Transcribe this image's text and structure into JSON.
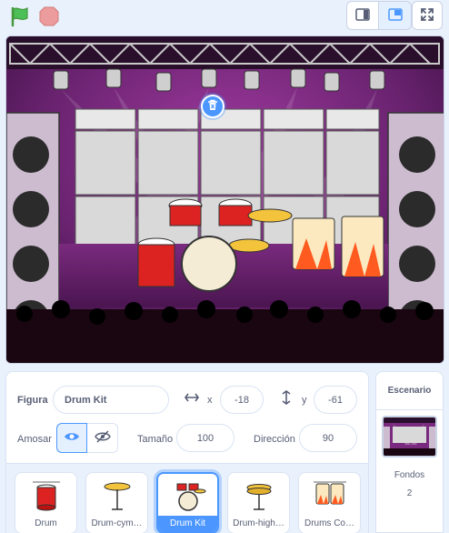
{
  "toolbar": {
    "flag_icon": "green-flag-icon",
    "stop_icon": "stop-icon",
    "small_stage_icon": "small-stage-icon",
    "normal_stage_icon": "normal-stage-icon",
    "fullscreen_icon": "fullscreen-icon"
  },
  "colors": {
    "accent": "#4c97ff",
    "flag": "#4cbf56",
    "stop": "#ec9c9c",
    "stage_bg": "#5a1d5c"
  },
  "sprite_info": {
    "sprite_label": "Figura",
    "sprite_name": "Drum Kit",
    "x_label": "x",
    "x_value": "-18",
    "y_label": "y",
    "y_value": "-61",
    "show_label": "Amosar",
    "size_label": "Tamaño",
    "size_value": "100",
    "direction_label": "Dirección",
    "direction_value": "90"
  },
  "sprites": [
    {
      "name": "Drum",
      "selected": false
    },
    {
      "name": "Drum-cym…",
      "selected": false
    },
    {
      "name": "Drum Kit",
      "selected": true
    },
    {
      "name": "Drum-high…",
      "selected": false
    },
    {
      "name": "Drums Co…",
      "selected": false
    }
  ],
  "stage_panel": {
    "title": "Escenario",
    "backdrops_label": "Fondos",
    "backdrops_count": "2"
  }
}
